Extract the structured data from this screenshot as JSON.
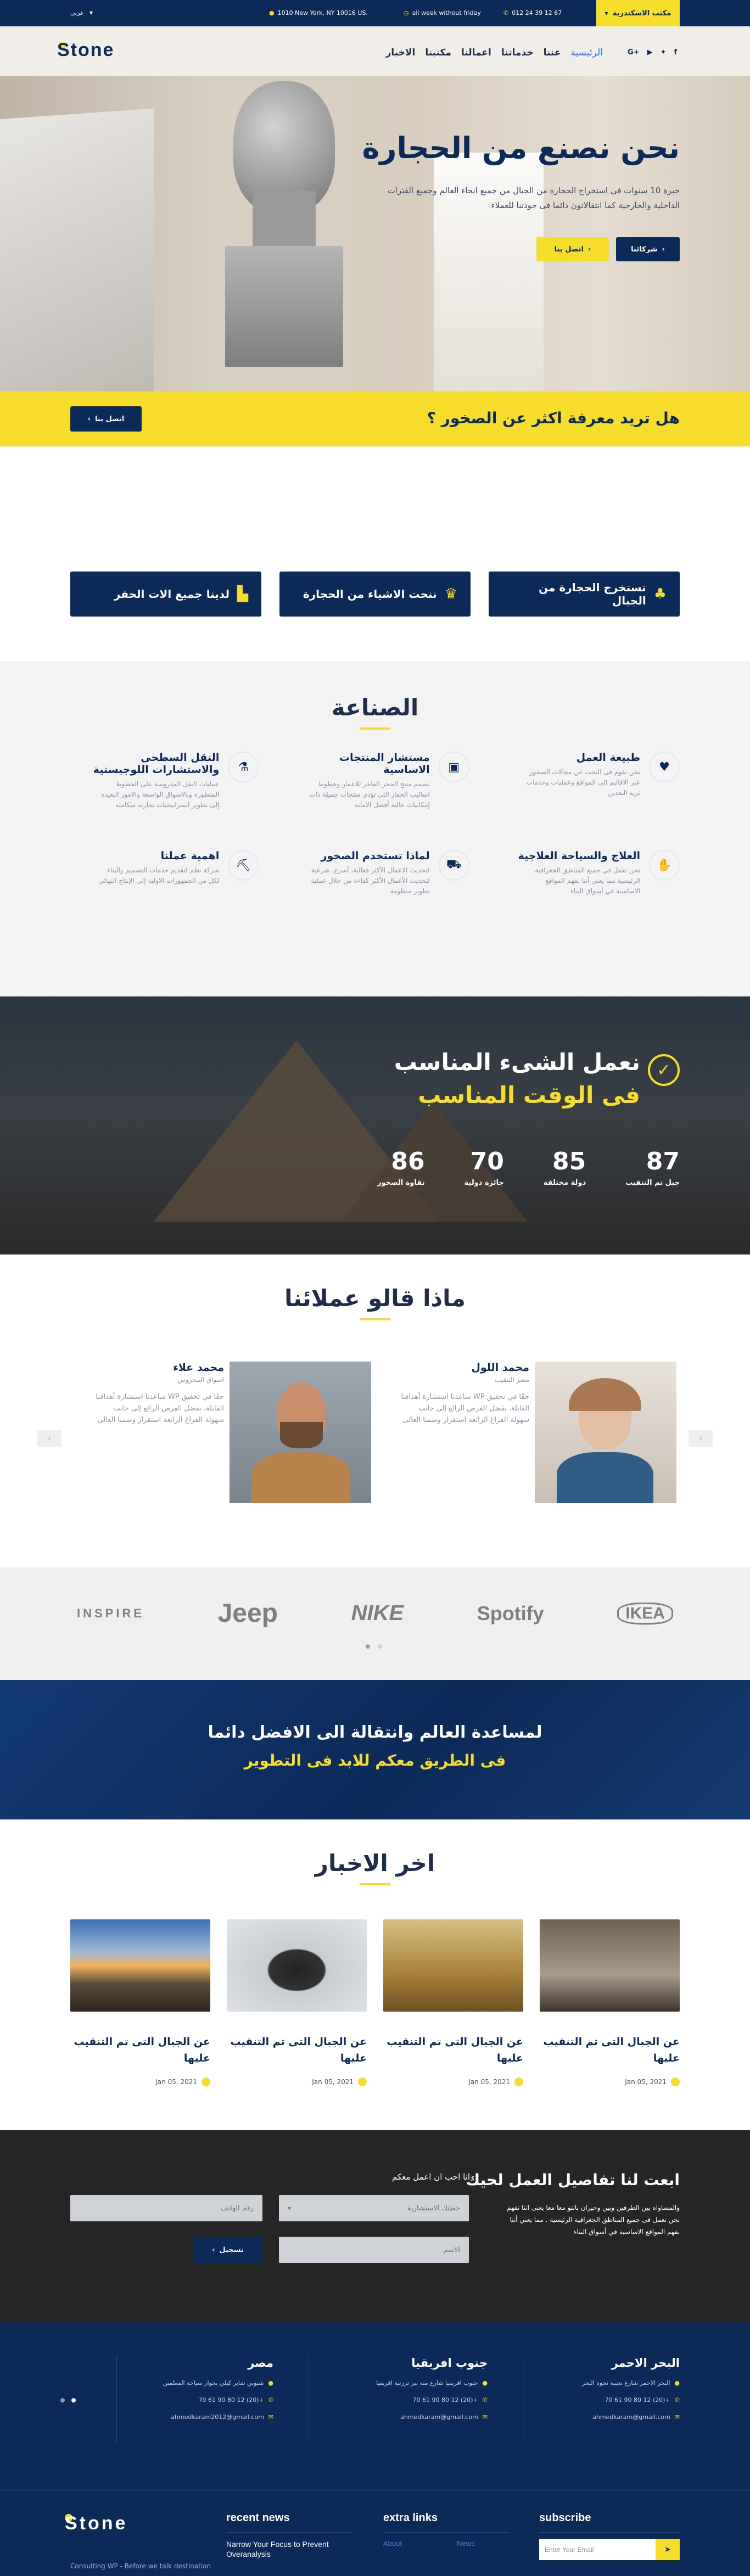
{
  "topbar": {
    "lang": "عربى",
    "address": "1010 New York, NY 10016 US.",
    "hours": "all week without friday",
    "phone": "012 24 39 12 67",
    "office_btn": "مكتب الاسكندرية"
  },
  "header": {
    "logo": "Stone",
    "nav": [
      "الرئيسية",
      "عننا",
      "خدماتنا",
      "اعمالنا",
      "مكتبنا",
      "الاخبار"
    ]
  },
  "hero": {
    "title": "نحن نصنع من الحجارة",
    "text": "خبرة 10 سنوات فى استخراج الحجارة من الجبال من جميع انحاء العالم وجميع الفترات الداخلية والخارجية كما انتقالاتون دائما فى جودتنا للعملاء",
    "btn_partners": "شركائنا",
    "btn_contact": "اتصل بنا"
  },
  "cta_bar": {
    "text": "هل تريد معرفة اكثر عن الصخور ؟",
    "btn": "اتصل بنا"
  },
  "features": [
    {
      "label": "نستخرج الحجارة من الجبال"
    },
    {
      "label": "ننحت الاشياء من الحجارة"
    },
    {
      "label": "لدينا جميع الات الحفر"
    }
  ],
  "industry": {
    "title": "الصناعة",
    "items": [
      {
        "title": "طبيعة العمل",
        "text": "نحن نقوم فى البحث عن مجالات الصخور عبر الاقاليم إلى المواقع وعمليات وخدمات ثرية التعدين"
      },
      {
        "title": "مستشار المنتجات الاساسية",
        "text": "نصمم منتج الحجر الفاخر للاعمار وخطوط اساليب الحفار التي تؤدي منتجات جميلة ذات إمكانيات عالية أفضل الامانة"
      },
      {
        "title": "النقل السطحى والاستشارات اللوجيستية",
        "text": "عمليات النقل المدروسة على الخطوط المتطورة وبالاسواق الواسعة والامور البعيدة إلى تطوير استراتيجيات تجارية متكاملة"
      },
      {
        "title": "العلاج والسياحة العلاجية",
        "text": "نحن نعمل في جميع المناطق الجغرافية الرئيسية مما يعني أننا نفهم المواقع الاساسية في أسواق البناء"
      },
      {
        "title": "لماذا تستخدم الصخور",
        "text": "لتحديث الاعمال الأكثر فعالية، أسرع، شرعية لتحديث الأعمال الأكثر كفاءة من خلال عملية تطوير منظومة"
      },
      {
        "title": "اهمية عملنا",
        "text": "شركة نظم لتقديم خدمات التصميم والبناء لكل من الجمهورات الاولية إلى الإنتاج النهائي"
      }
    ]
  },
  "stats": {
    "title1": "نعمل الشىء المناسب",
    "title2": "فى الوقت المناسب",
    "items": [
      {
        "num": "87",
        "label": "جبل تم التنقيب"
      },
      {
        "num": "85",
        "label": "دولة مختلفة"
      },
      {
        "num": "70",
        "label": "جائزة دولية"
      },
      {
        "num": "86",
        "label": "نقاوة الصخور"
      }
    ]
  },
  "testimonials": {
    "title": "ماذا قالو عملائنا",
    "items": [
      {
        "name": "محمد اللول",
        "role": "مصر التنقيب",
        "text": "حقًا في تحقيق WP ساعدنا استشارة أهدافنا القابلة، بفضل الفرص الرائع إلى جانب سهولة الفراغ الرائعة استقرار وضمنا العالى"
      },
      {
        "name": "محمد علاء",
        "role": "اسواق المحروس",
        "text": "حقًا في تحقيق WP ساعدنا استشارة أهدافنا القابلة، بفضل الفرص الرائع إلى جانب سهولة الفراغ الرائعة استقرار وضمنا العالى"
      }
    ]
  },
  "brands": [
    "INSPIRE",
    "Jeep",
    "NIKE",
    "Spotify",
    "IKEA"
  ],
  "banner": {
    "line1": "لمساعدة العالم وانتقالة الى الافضل دائما",
    "line2": "فى الطريق معكم للابد فى التطوير"
  },
  "news": {
    "title": "اخر الاخبار",
    "items": [
      {
        "title": "عن الجبال التى تم التنقيب عليها",
        "date": "Jan 05, 2021"
      },
      {
        "title": "عن الجبال التى تم التنقيب عليها",
        "date": "Jan 05, 2021"
      },
      {
        "title": "عن الجبال التى تم التنقيب عليها",
        "date": "Jan 05, 2021"
      },
      {
        "title": "عن الجبال التى تم التنقيب عليها",
        "date": "Jan 05, 2021"
      }
    ]
  },
  "contact_form": {
    "title": "ابعت لنا تفاصيل العمل لحيك",
    "text": "والمساواه بين الطرفين وبين وحيران بانتو معا معا يعنى انتا نفهم نحن نعمل فى جميع المناطق الجغرافية الرئيسية . مما يعني أننا نفهم المواقع الاساسية في أسواق البناء",
    "subtitle": "انا احب ان اعمل معكم",
    "consult_ph": "خطتك الاستشارية",
    "phone_ph": "رقم الهاتف",
    "name_ph": "الاسم",
    "submit": "تسجيل"
  },
  "offices": [
    {
      "title": "البحر الاحمر",
      "address": "البحر الاحمر شارع نجيبة نجوة البحر",
      "phone": "+(20) 12 80 90 61 70",
      "email": "ahmedkaram@gmail.com"
    },
    {
      "title": "جنوب افريقيا",
      "address": "جنوب افريقيا شارع منه بيز ترزنية افريقيا",
      "phone": "+(20) 12 80 90 61 70",
      "email": "ahmedkaram@gmail.com"
    },
    {
      "title": "مصر",
      "address": "شبوبي شاير كيلي بجوار سياحة المعلمين",
      "phone": "+(20) 12 80 90 61 70",
      "email": "ahmedkaram2012@gmail.com"
    }
  ],
  "footer": {
    "logo": "Stone",
    "tagline": "Consulting WP - Before we talk destination",
    "recent_news": "recent news",
    "news_item": "Narrow Your Focus to Prevent Overanalysis",
    "extra_links": "extra links",
    "link1": "About",
    "link2": "News",
    "subscribe": "subscribe",
    "email_ph": "Enter Your Email"
  },
  "colors": {
    "navy": "#0c2a58",
    "yellow": "#f6dd2b"
  }
}
